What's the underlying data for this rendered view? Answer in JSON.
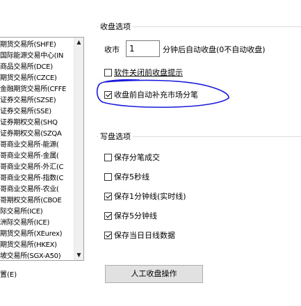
{
  "exchanges": [
    "期货交易所(SHFE)",
    "国际能源交易中心(IN",
    "商品交易所(DCE)",
    "期货交易所(CZCE)",
    "金融期货交易所(CFFE",
    "证券交易所(SZSE)",
    "证券交易所(SSE)",
    "证券期权交易(SHQ",
    "证券期权交易(SZQA",
    "哥商业交易所-能源(",
    "哥商业交易所-金属(",
    "哥商业交易所-外汇(C",
    "哥商业交易所-指数(C",
    "哥商业交易所-农业(",
    "哥期权交易所(CBOE",
    "际交易所(ICE)",
    "洲际交易所(ICE)",
    "期货交易所(XEurex)",
    "期货交易所(HKEX)",
    "坡交易所(SGX-A50)"
  ],
  "bottom_left_label": "置(E)",
  "close_group": {
    "title": "收盘选项",
    "close_label": "收市",
    "minutes_value": "1",
    "after_label": "分钟后自动收盘(0不自动收盘)",
    "software_close_prompt": {
      "label": "软件关闭前收盘提示",
      "checked": false
    },
    "auto_fill_market": {
      "label": "收盘前自动补充市场分笔",
      "checked": true
    }
  },
  "write_group": {
    "title": "写盘选项",
    "options": [
      {
        "label": "保存分笔成交",
        "checked": false
      },
      {
        "label": "保存5秒线",
        "checked": false
      },
      {
        "label": "保存1分钟线(实时线)",
        "checked": true
      },
      {
        "label": "保存5分钟线",
        "checked": true
      },
      {
        "label": "保存当日日线数据",
        "checked": true
      }
    ]
  },
  "manual_close_button": "人工收盘操作",
  "annotation_color": "#1a1adc"
}
